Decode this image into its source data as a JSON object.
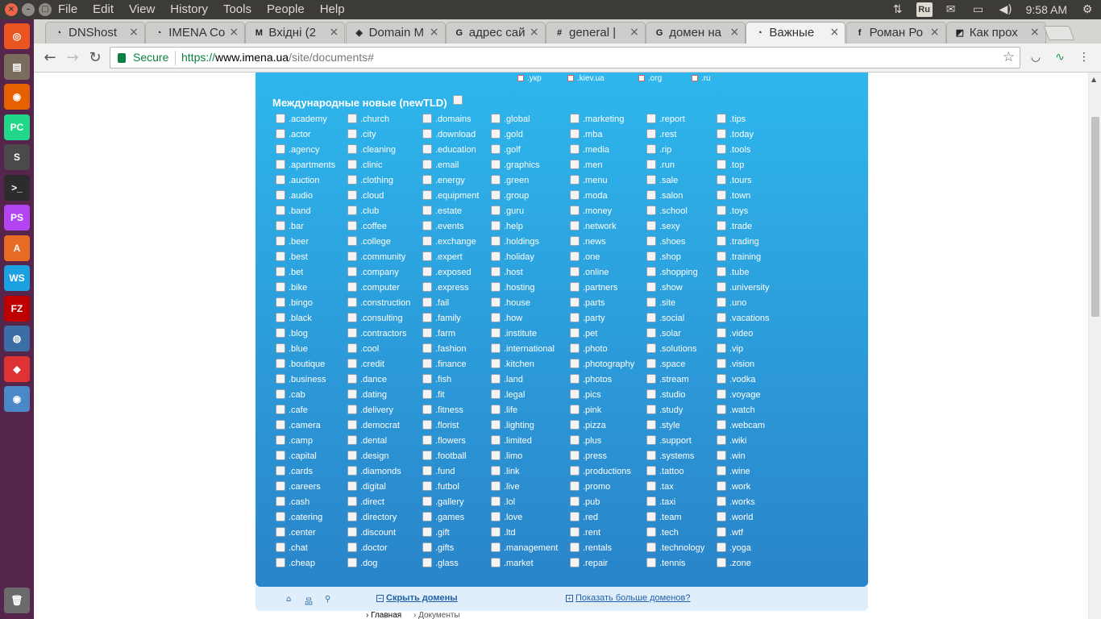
{
  "menubar": {
    "items": [
      "File",
      "Edit",
      "View",
      "History",
      "Tools",
      "People",
      "Help"
    ],
    "tray": {
      "keyboard_layout": "Ru",
      "clock": "9:58 AM",
      "icons": [
        "network-icon",
        "mail-icon",
        "battery-icon",
        "volume-icon",
        "gear-icon"
      ]
    }
  },
  "launcher": {
    "apps": [
      {
        "name": "ubuntu-dash-icon",
        "glyph": "◎",
        "color": "#e95420"
      },
      {
        "name": "files-icon",
        "glyph": "▤",
        "color": "#7a6d5e"
      },
      {
        "name": "firefox-icon",
        "glyph": "◉",
        "color": "#e66000"
      },
      {
        "name": "pycharm-icon",
        "glyph": "PC",
        "color": "#21d789"
      },
      {
        "name": "sublime-icon",
        "glyph": "S",
        "color": "#4a4a4a"
      },
      {
        "name": "terminal-icon",
        "glyph": ">_",
        "color": "#2c2c2c"
      },
      {
        "name": "phpstorm-icon",
        "glyph": "PS",
        "color": "#b345f1"
      },
      {
        "name": "software-center-icon",
        "glyph": "A",
        "color": "#e86b25"
      },
      {
        "name": "webstorm-icon",
        "glyph": "WS",
        "color": "#1ba1e2"
      },
      {
        "name": "filezilla-icon",
        "glyph": "FZ",
        "color": "#bf0000"
      },
      {
        "name": "network-globe-icon",
        "glyph": "◍",
        "color": "#3b6ea5"
      },
      {
        "name": "git-icon",
        "glyph": "◆",
        "color": "#d33"
      },
      {
        "name": "chrome-icon",
        "glyph": "◉",
        "color": "#4a88c7"
      },
      {
        "name": "trash-icon",
        "glyph": "🗑",
        "color": "#6b6b6b"
      }
    ]
  },
  "tabs": [
    {
      "title": "DNShost",
      "icon": "◔",
      "active": false
    },
    {
      "title": "IMENA Co",
      "icon": "◔",
      "active": false
    },
    {
      "title": "Вхідні (2",
      "icon": "M",
      "active": false
    },
    {
      "title": "Domain M",
      "icon": "◈",
      "active": false
    },
    {
      "title": "адрес сай",
      "icon": "G",
      "active": false
    },
    {
      "title": "general |",
      "icon": "#",
      "active": false
    },
    {
      "title": "домен на",
      "icon": "G",
      "active": false
    },
    {
      "title": "Важные ",
      "icon": "◔",
      "active": true
    },
    {
      "title": "Роман Ро",
      "icon": "f",
      "active": false
    },
    {
      "title": "Как прох",
      "icon": "◩",
      "active": false
    }
  ],
  "toolbar": {
    "secure_label": "Secure",
    "url_scheme": "https://",
    "url_host": "www.imena.ua",
    "url_path": "/site/documents#"
  },
  "page": {
    "cc_tlds": [
      ".укр",
      ".kiev.ua",
      ".org",
      ".ru"
    ],
    "section_title": "Международные новые (newTLD)",
    "columns": [
      [
        ".academy",
        ".actor",
        ".agency",
        ".apartments",
        ".auction",
        ".audio",
        ".band",
        ".bar",
        ".beer",
        ".best",
        ".bet",
        ".bike",
        ".bingo",
        ".black",
        ".blog",
        ".blue",
        ".boutique",
        ".business",
        ".cab",
        ".cafe",
        ".camera",
        ".camp",
        ".capital",
        ".cards",
        ".careers",
        ".cash",
        ".catering",
        ".center",
        ".chat",
        ".cheap"
      ],
      [
        ".church",
        ".city",
        ".cleaning",
        ".clinic",
        ".clothing",
        ".cloud",
        ".club",
        ".coffee",
        ".college",
        ".community",
        ".company",
        ".computer",
        ".construction",
        ".consulting",
        ".contractors",
        ".cool",
        ".credit",
        ".dance",
        ".dating",
        ".delivery",
        ".democrat",
        ".dental",
        ".design",
        ".diamonds",
        ".digital",
        ".direct",
        ".directory",
        ".discount",
        ".doctor",
        ".dog"
      ],
      [
        ".domains",
        ".download",
        ".education",
        ".email",
        ".energy",
        ".equipment",
        ".estate",
        ".events",
        ".exchange",
        ".expert",
        ".exposed",
        ".express",
        ".fail",
        ".family",
        ".farm",
        ".fashion",
        ".finance",
        ".fish",
        ".fit",
        ".fitness",
        ".florist",
        ".flowers",
        ".football",
        ".fund",
        ".futbol",
        ".gallery",
        ".games",
        ".gift",
        ".gifts",
        ".glass"
      ],
      [
        ".global",
        ".gold",
        ".golf",
        ".graphics",
        ".green",
        ".group",
        ".guru",
        ".help",
        ".holdings",
        ".holiday",
        ".host",
        ".hosting",
        ".house",
        ".how",
        ".institute",
        ".international",
        ".kitchen",
        ".land",
        ".legal",
        ".life",
        ".lighting",
        ".limited",
        ".limo",
        ".link",
        ".live",
        ".lol",
        ".love",
        ".ltd",
        ".management",
        ".market"
      ],
      [
        ".marketing",
        ".mba",
        ".media",
        ".men",
        ".menu",
        ".moda",
        ".money",
        ".network",
        ".news",
        ".one",
        ".online",
        ".partners",
        ".parts",
        ".party",
        ".pet",
        ".photo",
        ".photography",
        ".photos",
        ".pics",
        ".pink",
        ".pizza",
        ".plus",
        ".press",
        ".productions",
        ".promo",
        ".pub",
        ".red",
        ".rent",
        ".rentals",
        ".repair"
      ],
      [
        ".report",
        ".rest",
        ".rip",
        ".run",
        ".sale",
        ".salon",
        ".school",
        ".sexy",
        ".shoes",
        ".shop",
        ".shopping",
        ".show",
        ".site",
        ".social",
        ".solar",
        ".solutions",
        ".space",
        ".stream",
        ".studio",
        ".study",
        ".style",
        ".support",
        ".systems",
        ".tattoo",
        ".tax",
        ".taxi",
        ".team",
        ".tech",
        ".technology",
        ".tennis"
      ],
      [
        ".tips",
        ".today",
        ".tools",
        ".top",
        ".tours",
        ".town",
        ".toys",
        ".trade",
        ".trading",
        ".training",
        ".tube",
        ".university",
        ".uno",
        ".vacations",
        ".video",
        ".vip",
        ".vision",
        ".vodka",
        ".voyage",
        ".watch",
        ".webcam",
        ".wiki",
        ".win",
        ".wine",
        ".work",
        ".works",
        ".world",
        ".wtf",
        ".yoga",
        ".zone"
      ]
    ],
    "hide_domains_label": "Скрыть домены",
    "show_more_label": "Показать больше доменов?",
    "breadcrumb": [
      "Главная",
      "Документы"
    ]
  }
}
